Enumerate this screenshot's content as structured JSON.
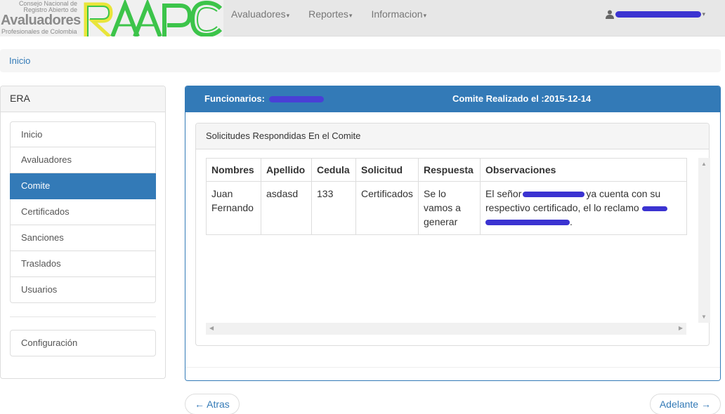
{
  "brand": {
    "line1": "Consejo Nacional de",
    "line2": "Registro Abierto de",
    "name": "Avaluadores",
    "line3": "Profesionales de Colombia",
    "mark": "RAAPC",
    "colors": {
      "green": "#3cc44a",
      "yellow": "#e9e53a"
    }
  },
  "nav": {
    "items": [
      {
        "label": "Avaluadores"
      },
      {
        "label": "Reportes"
      },
      {
        "label": "Informacion"
      }
    ],
    "user_icon": "user-icon"
  },
  "breadcrumb": {
    "home": "Inicio"
  },
  "sidebar": {
    "title": "ERA",
    "items": [
      {
        "label": "Inicio"
      },
      {
        "label": "Avaluadores"
      },
      {
        "label": "Comite"
      },
      {
        "label": "Certificados"
      },
      {
        "label": "Sanciones"
      },
      {
        "label": "Traslados"
      },
      {
        "label": "Usuarios"
      }
    ],
    "active": "Comite",
    "config": "Configuración"
  },
  "panel": {
    "funcionarios_label": "Funcionarios:",
    "comite_label": "Comite Realizado el :",
    "comite_date": "2015-12-14",
    "inner_title": "Solicitudes Respondidas En el Comite"
  },
  "table": {
    "headers": [
      "Nombres",
      "Apellido",
      "Cedula",
      "Solicitud",
      "Respuesta",
      "Observaciones"
    ],
    "row": {
      "nombres": "Juan Fernando",
      "apellido": "asdasd",
      "cedula": "133",
      "solicitud": "Certificados",
      "respuesta": "Se lo vamos a generar",
      "obs_part1": "El señor",
      "obs_part2": "ya cuenta con su respectivo certificado, el lo reclamo",
      "obs_part3": "."
    }
  },
  "pager": {
    "prev": "← Atras",
    "next": "Adelante →"
  },
  "colors": {
    "primary": "#337ab7",
    "redaction": "#3b33d1"
  }
}
